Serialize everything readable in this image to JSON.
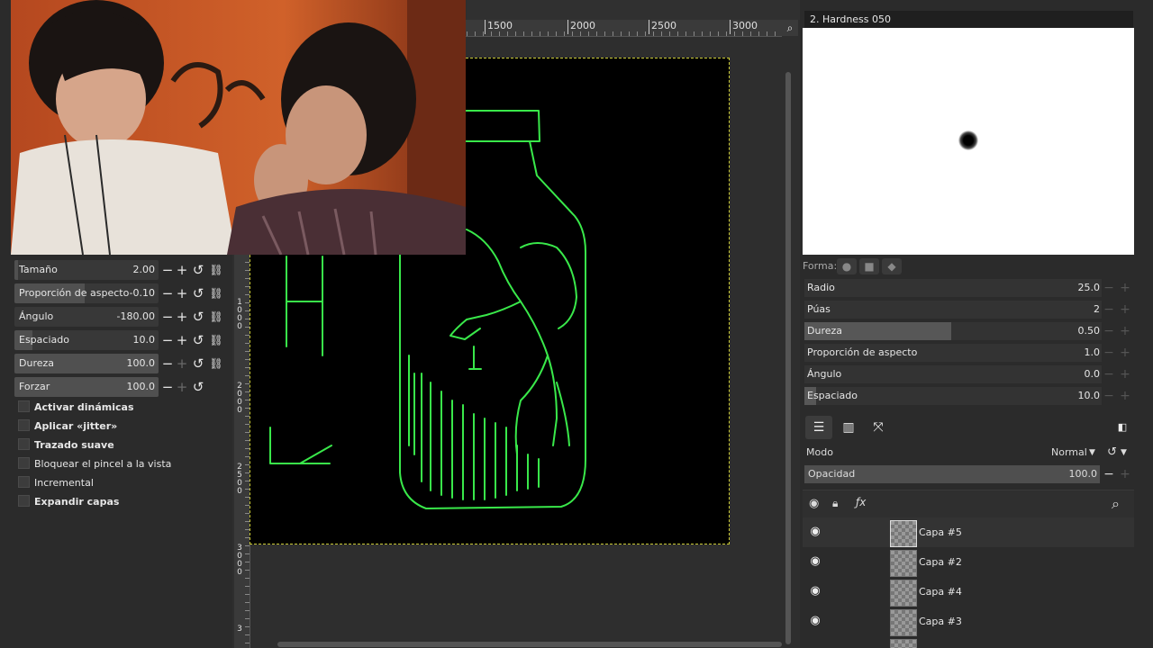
{
  "ruler": {
    "ticks": [
      "1500",
      "2000",
      "2500",
      "3000"
    ],
    "vticks": [
      "1000",
      "2000",
      "2500",
      "3000",
      "3"
    ]
  },
  "tool_options": {
    "sliders": [
      {
        "label": "Tamaño",
        "value": "2.00",
        "fill": 0.02
      },
      {
        "label": "Proporción de aspecto",
        "value": "-0.10",
        "fill": 0.48
      },
      {
        "label": "Ángulo",
        "value": "-180.00",
        "fill": 0.0
      },
      {
        "label": "Espaciado",
        "value": "10.0",
        "fill": 0.12
      },
      {
        "label": "Dureza",
        "value": "100.0",
        "fill": 1.0
      },
      {
        "label": "Forzar",
        "value": "100.0",
        "fill": 1.0
      }
    ],
    "checks": [
      {
        "label": "Activar dinámicas",
        "bold": true
      },
      {
        "label": "Aplicar «jitter»",
        "bold": true
      },
      {
        "label": "Trazado suave",
        "bold": true
      },
      {
        "label": "Bloquear el pincel a la vista",
        "bold": false
      },
      {
        "label": "Incremental",
        "bold": false
      },
      {
        "label": "Expandir capas",
        "bold": true
      }
    ]
  },
  "brush_editor": {
    "title": "2. Hardness 050",
    "shape_label": "Forma:",
    "params": [
      {
        "label": "Radio",
        "value": "25.0",
        "fill": 0.0
      },
      {
        "label": "Púas",
        "value": "2",
        "fill": 0.0
      },
      {
        "label": "Dureza",
        "value": "0.50",
        "fill": 0.5
      },
      {
        "label": "Proporción de aspecto",
        "value": "1.0",
        "fill": 0.0
      },
      {
        "label": "Ángulo",
        "value": "0.0",
        "fill": 0.0
      },
      {
        "label": "Espaciado",
        "value": "10.0",
        "fill": 0.04
      }
    ]
  },
  "layers": {
    "mode_label": "Modo",
    "mode_value": "Normal",
    "opacity_label": "Opacidad",
    "opacity_value": "100.0",
    "items": [
      {
        "name": "Capa #5",
        "selected": true
      },
      {
        "name": "Capa #2",
        "selected": false
      },
      {
        "name": "Capa #4",
        "selected": false
      },
      {
        "name": "Capa #3",
        "selected": false
      }
    ]
  },
  "colors": {
    "accent_stroke": "#39e84a",
    "selection_border": "#c9c935",
    "background": "#2b2b2b"
  }
}
